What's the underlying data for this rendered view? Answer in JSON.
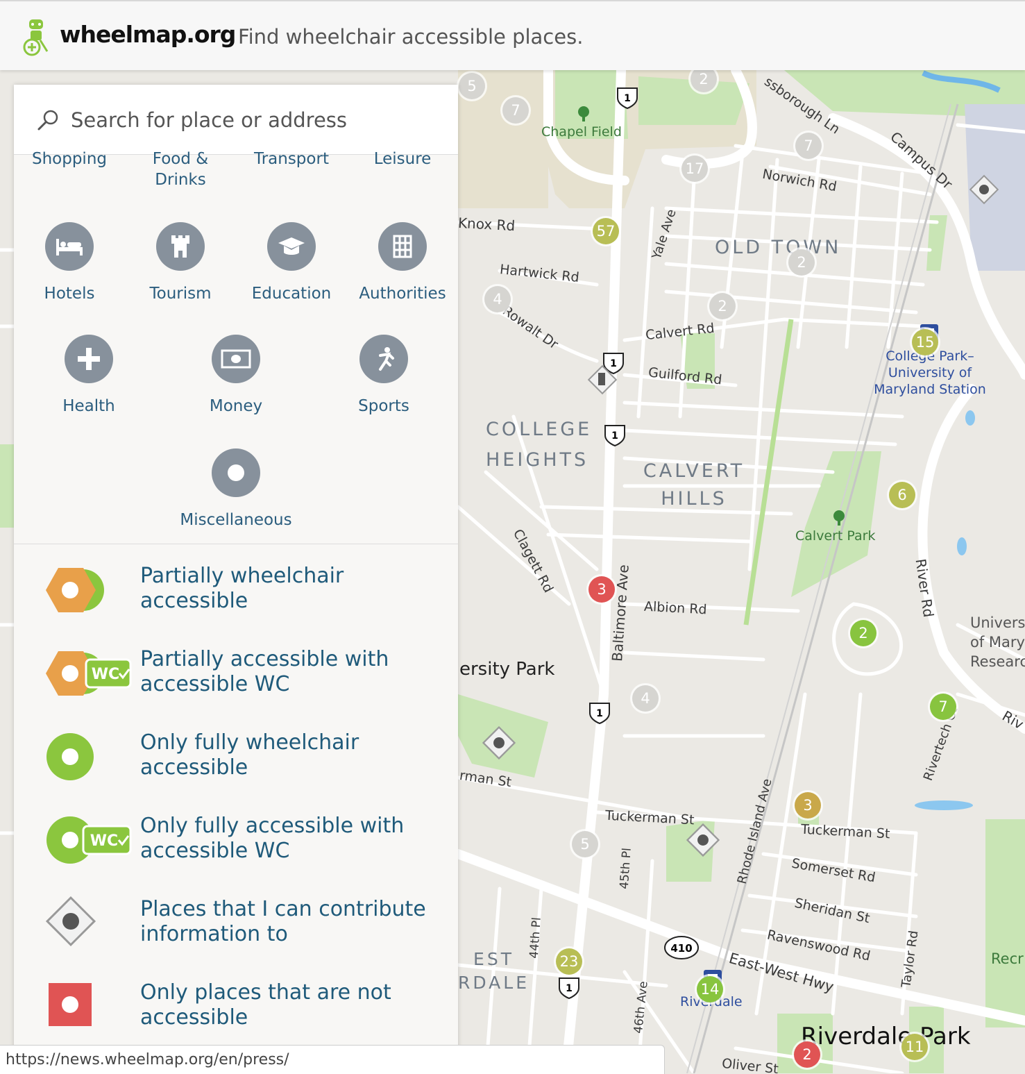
{
  "header": {
    "logo_text": "wheelmap.org",
    "tagline": "Find wheelchair accessible places."
  },
  "search": {
    "placeholder": "Search for place or address"
  },
  "categories_partial": [
    {
      "label": "Shopping"
    },
    {
      "label": "Food & Drinks"
    },
    {
      "label": "Transport"
    },
    {
      "label": "Leisure"
    }
  ],
  "categories": [
    {
      "label": "Hotels",
      "icon": "bed-icon"
    },
    {
      "label": "Tourism",
      "icon": "castle-icon"
    },
    {
      "label": "Education",
      "icon": "graduation-cap-icon"
    },
    {
      "label": "Authorities",
      "icon": "building-icon"
    },
    {
      "label": "Health",
      "icon": "plus-icon"
    },
    {
      "label": "Money",
      "icon": "banknote-icon"
    },
    {
      "label": "Sports",
      "icon": "runner-icon"
    },
    {
      "label": "Miscellaneous",
      "icon": "dot-icon"
    }
  ],
  "legend": [
    {
      "label": "Partially wheelchair accessible",
      "icon": "partial-icon",
      "color": "#e8a04a"
    },
    {
      "label": "Partially accessible with accessible WC",
      "icon": "partial-wc-icon",
      "wc": "WC"
    },
    {
      "label": "Only fully wheelchair accessible",
      "icon": "full-icon",
      "color": "#8bc63e"
    },
    {
      "label": "Only fully accessible with accessible WC",
      "icon": "full-wc-icon",
      "wc": "WC"
    },
    {
      "label": "Places that I can contribute information to",
      "icon": "unknown-icon"
    },
    {
      "label": "Only places that are not accessible",
      "icon": "not-accessible-icon",
      "color": "#e05454"
    }
  ],
  "map": {
    "districts": [
      "OLD TOWN",
      "COLLEGE HEIGHTS",
      "CALVERT HILLS"
    ],
    "parks": [
      "Chapel Field",
      "Calvert Park"
    ],
    "station": "College Park–University of Maryland Station",
    "riverdale_station": "Riverdale",
    "streets": [
      "Knox Rd",
      "Hartwick Rd",
      "Rowalt Dr",
      "Calvert Rd",
      "Guilford Rd",
      "Yale Ave",
      "Norwich Rd",
      "Campus Dr",
      "Albion Rd",
      "Clagett Rd",
      "Baltimore Ave",
      "Tuckerman St",
      "Somerset Rd",
      "Sheridan St",
      "Ravenswood Rd",
      "Taylor Rd",
      "East-West Hwy",
      "Rhode Island Ave",
      "45th Pl",
      "44th Pl",
      "46th Ave",
      "River Rd",
      "Rivertech Ct",
      "Oliver St",
      "ssborough Ln",
      "ersity Park",
      "rman St"
    ],
    "places": [
      "Riverdale Park"
    ],
    "partial_labels": [
      "Univers",
      "of Maryl",
      "Research",
      "Recr",
      "Riv",
      "EST",
      "RDALE"
    ],
    "shields": [
      "1",
      "1",
      "1",
      "1",
      "1",
      "1",
      "410"
    ],
    "clusters": [
      {
        "count": "5",
        "kind": "grey"
      },
      {
        "count": "7",
        "kind": "grey"
      },
      {
        "count": "2",
        "kind": "grey"
      },
      {
        "count": "7",
        "kind": "grey"
      },
      {
        "count": "17",
        "kind": "grey"
      },
      {
        "count": "57",
        "kind": "olive"
      },
      {
        "count": "2",
        "kind": "grey"
      },
      {
        "count": "2",
        "kind": "grey"
      },
      {
        "count": "4",
        "kind": "grey"
      },
      {
        "count": "15",
        "kind": "olive"
      },
      {
        "count": "6",
        "kind": "olive"
      },
      {
        "count": "3",
        "kind": "red"
      },
      {
        "count": "2",
        "kind": "green"
      },
      {
        "count": "4",
        "kind": "grey"
      },
      {
        "count": "7",
        "kind": "green"
      },
      {
        "count": "3",
        "kind": "gold"
      },
      {
        "count": "5",
        "kind": "grey"
      },
      {
        "count": "23",
        "kind": "olive"
      },
      {
        "count": "14",
        "kind": "green"
      },
      {
        "count": "11",
        "kind": "olive"
      },
      {
        "count": "2",
        "kind": "red"
      }
    ]
  },
  "statusbar": {
    "url": "https://news.wheelmap.org/en/press/"
  },
  "colors": {
    "accent": "#2b5d7e",
    "partial": "#e8a04a",
    "full": "#8bc63e",
    "not_accessible": "#e05454",
    "category_icon_bg": "#87919c"
  }
}
